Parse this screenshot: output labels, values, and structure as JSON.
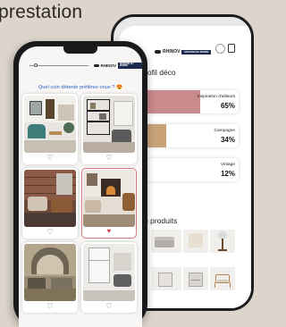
{
  "headline": "prestation",
  "back_phone": {
    "brand_name": "RHINOV",
    "brand_partner": "MAISONS DU MONDE",
    "profile_title": "ofil déco",
    "styles": [
      {
        "label": "Inspiration d'ailleurs",
        "percent": "65%",
        "value": 0.65,
        "color": "#c98a8c"
      },
      {
        "label": "Campagne",
        "percent": "34%",
        "value": 0.34,
        "color": "#c9a277"
      },
      {
        "label": "Vintage",
        "percent": "12%",
        "value": 0.12,
        "color": "#2f4a42"
      }
    ],
    "products_title": "p produits"
  },
  "front_phone": {
    "brand_name": "RHINOV",
    "brand_partner": "MAISONS DU MONDE",
    "progress": 0.1,
    "question": "Quel coin détente préférez-vous ?",
    "question_emoji": "😍",
    "cards": [
      {
        "name": "living-room-velvet-sofa",
        "liked": false
      },
      {
        "name": "black-shelving-unit-room",
        "liked": false
      },
      {
        "name": "brick-wall-leather-armchairs",
        "liked": false
      },
      {
        "name": "fireplace-leather-armchair",
        "liked": true
      },
      {
        "name": "rustic-stone-living-room",
        "liked": false
      },
      {
        "name": "white-cabinet-living-room",
        "liked": false
      }
    ],
    "heart_empty": "♡",
    "heart_filled": "♥"
  },
  "colors": {
    "background": "#ddd5cb",
    "question_text": "#2f63c2",
    "selected_border": "#d9787e",
    "heart_active": "#d5434f"
  }
}
